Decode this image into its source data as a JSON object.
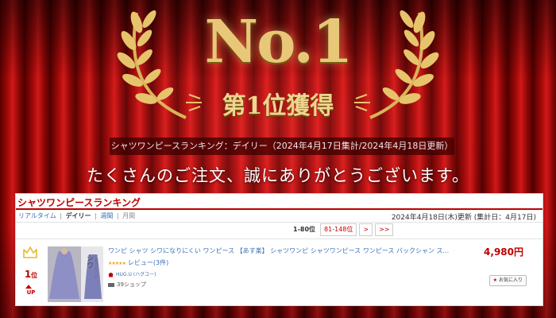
{
  "banner": {
    "headline": "No.1",
    "award": "第1位獲得",
    "ranking_label": "シャツワンピースランキング：デイリー（2024年4月17日集計/2024年4月18日更新）",
    "thanks": "たくさんのご注文、誠にありがとうございます。"
  },
  "colors": {
    "accent_red": "#bf0000",
    "gold": "#e8c878",
    "link_blue": "#3a6fb0",
    "star_orange": "#f5a623"
  },
  "ranking": {
    "title": "シャツワンピースランキング",
    "period_tabs": [
      {
        "label": "リアルタイム"
      },
      {
        "label": "デイリー"
      },
      {
        "label": "週間"
      },
      {
        "label": "月間"
      }
    ],
    "active_period": "デイリー",
    "updated": "2024年4月18日(木)更新 (集計日：4月17日)",
    "pager": {
      "range": "1-80位",
      "next_page": "81-148位",
      "next": ">",
      "last": ">>"
    },
    "item": {
      "rank": "1",
      "rank_suffix": "位",
      "trend": "UP",
      "thumb_text": "シワ",
      "thumb_subtext": "になりにくい",
      "title": "ワンピ シャツ シワになりにくい ワンピース 【あす楽】 シャツワンピ シャツワンピース ワンピース バックシャン ス...",
      "price": "4,980円",
      "stars": "★★★★★",
      "review": "レビュー(3件)",
      "shop": "HUG.U (ハグユー)",
      "shipping": "39ショップ",
      "favorite": "お気に入り",
      "icons": [
        "crown-icon",
        "up-arrow-icon",
        "shop-house-icon",
        "truck-icon",
        "favorite-star-icon"
      ]
    }
  }
}
